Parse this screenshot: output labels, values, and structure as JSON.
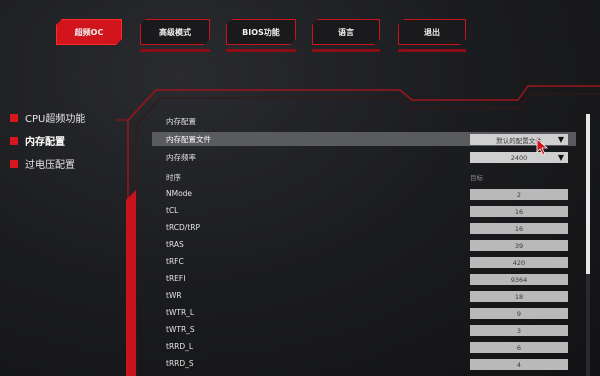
{
  "tabs": [
    {
      "label": "超频OC",
      "active": true
    },
    {
      "label": "高级模式",
      "active": false
    },
    {
      "label": "BIOS功能",
      "active": false
    },
    {
      "label": "语言",
      "active": false
    },
    {
      "label": "退出",
      "active": false
    }
  ],
  "sidebar": {
    "items": [
      {
        "label": "CPU超频功能"
      },
      {
        "label": "内存配置"
      },
      {
        "label": "过电压配置"
      }
    ]
  },
  "content": {
    "section_title": "内存配置",
    "profile": {
      "label": "内存配置文件",
      "value": "默认的配置文件"
    },
    "frequency": {
      "label": "内存频率",
      "value": "2400"
    },
    "timing_header": "时序",
    "target_header": "目标",
    "timings": [
      {
        "label": "NMode",
        "value": "2"
      },
      {
        "label": "tCL",
        "value": "16"
      },
      {
        "label": "tRCD/tRP",
        "value": "16"
      },
      {
        "label": "tRAS",
        "value": "39"
      },
      {
        "label": "tRFC",
        "value": "420"
      },
      {
        "label": "tREFI",
        "value": "9364"
      },
      {
        "label": "tWR",
        "value": "18"
      },
      {
        "label": "tWTR_L",
        "value": "9"
      },
      {
        "label": "tWTR_S",
        "value": "3"
      },
      {
        "label": "tRRD_L",
        "value": "6"
      },
      {
        "label": "tRRD_S",
        "value": "4"
      }
    ]
  },
  "icons": {
    "dropdown": "triangle-down-icon",
    "cursor": "mouse-pointer-icon",
    "bullet": "red-square-icon"
  },
  "colors": {
    "accent": "#d2141c",
    "highlight_row": "#5a5b5e",
    "value_box": "#b9b9b9"
  }
}
